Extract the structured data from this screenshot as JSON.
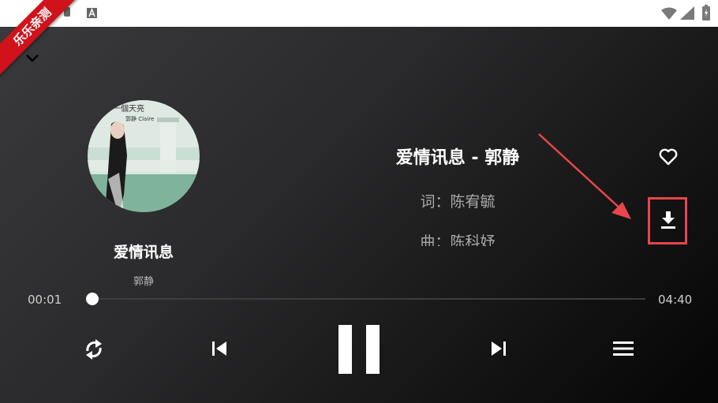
{
  "ribbon": {
    "text": "乐乐亲测"
  },
  "song": {
    "title": "爱情讯息",
    "artist": "郭静"
  },
  "lyrics": {
    "title": "爱情讯息 - 郭静",
    "lines": [
      "词：陈宥毓",
      "曲：陈科妤"
    ]
  },
  "album_cover": {
    "text_top": "下一個天亮",
    "text_sub": "郭静 Claire"
  },
  "progress": {
    "current": "00:01",
    "total": "04:40",
    "fraction": 0.004
  },
  "colors": {
    "accent_annotation": "#e8464a",
    "ribbon": "#d0121b"
  },
  "icons": {
    "collapse": "chevron-down-icon",
    "favorite": "heart-icon",
    "download": "download-icon",
    "repeat": "repeat-icon",
    "previous": "skip-previous-icon",
    "play_pause": "pause-icon",
    "next": "skip-next-icon",
    "playlist": "playlist-icon"
  }
}
